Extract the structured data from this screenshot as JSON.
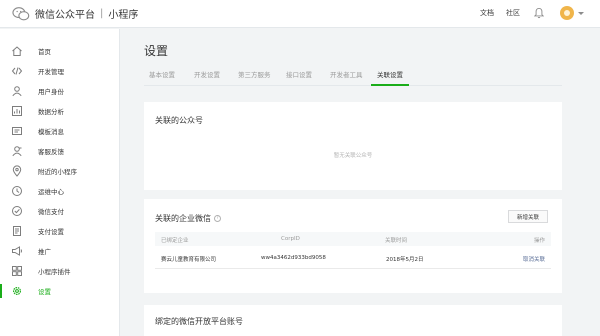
{
  "header": {
    "title": "微信公众平台",
    "separator": "|",
    "subtitle": "小程序",
    "links": [
      "文档",
      "社区"
    ],
    "icons": [
      "wechat-logo-icon",
      "bell-icon",
      "avatar"
    ]
  },
  "sidebar": {
    "items": [
      {
        "label": "首页",
        "icon": "home-icon"
      },
      {
        "label": "开发管理",
        "icon": "code-icon"
      },
      {
        "label": "用户身份",
        "icon": "user-icon"
      },
      {
        "label": "数据分析",
        "icon": "chart-icon"
      },
      {
        "label": "模板消息",
        "icon": "message-icon"
      },
      {
        "label": "客服反馈",
        "icon": "customer-icon"
      },
      {
        "label": "附近的小程序",
        "icon": "location-icon"
      },
      {
        "label": "运维中心",
        "icon": "operations-icon"
      },
      {
        "label": "微信支付",
        "icon": "payment-icon"
      },
      {
        "label": "支付设置",
        "icon": "payment-settings-icon"
      },
      {
        "label": "推广",
        "icon": "promote-icon"
      },
      {
        "label": "小程序插件",
        "icon": "plugin-icon"
      },
      {
        "label": "设置",
        "icon": "gear-icon",
        "active": true
      }
    ]
  },
  "main": {
    "title": "设置",
    "tabs": [
      {
        "label": "基本设置"
      },
      {
        "label": "开发设置"
      },
      {
        "label": "第三方服务"
      },
      {
        "label": "接口设置"
      },
      {
        "label": "开发者工具"
      },
      {
        "label": "关联设置",
        "active": true
      }
    ],
    "oa_section": {
      "title": "关联的公众号",
      "empty_text": "暂无关联公众号"
    },
    "wework_section": {
      "title": "关联的企业微信",
      "info_icon": "?",
      "add_button": "新增关联",
      "columns": [
        "已绑定企业",
        "CorpID",
        "关联时间",
        "操作"
      ],
      "rows": [
        {
          "company": "赛云儿童教育有限公司",
          "corpid": "ww4a3462d933bd9058",
          "time": "2018年5月2日",
          "action": "取消关联"
        }
      ]
    },
    "open_platform_section": {
      "title": "绑定的微信开放平台账号"
    }
  },
  "colors": {
    "accent": "#1aad19",
    "link": "#576b95",
    "background": "#f2f4f5"
  }
}
